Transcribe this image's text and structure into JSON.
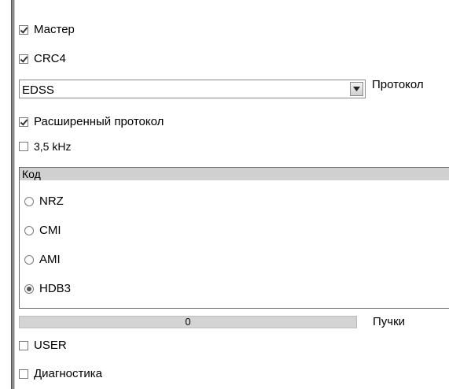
{
  "checkboxes": {
    "master": {
      "label": "Мастер",
      "checked": true
    },
    "crc4": {
      "label": "CRC4",
      "checked": true
    },
    "extended_protocol": {
      "label": "Расширенный протокол",
      "checked": true
    },
    "khz": {
      "label": "3,5 kHz",
      "checked": false
    },
    "user": {
      "label": "USER",
      "checked": false
    },
    "diagnostics": {
      "label": "Диагностика",
      "checked": false
    }
  },
  "protocol": {
    "value": "EDSS",
    "label": "Протокол"
  },
  "code_group": {
    "title": "Код",
    "options": [
      {
        "label": "NRZ",
        "selected": false
      },
      {
        "label": "CMI",
        "selected": false
      },
      {
        "label": "AMI",
        "selected": false
      },
      {
        "label": "HDB3",
        "selected": true
      }
    ]
  },
  "bundles": {
    "value": "0",
    "label": "Пучки"
  }
}
